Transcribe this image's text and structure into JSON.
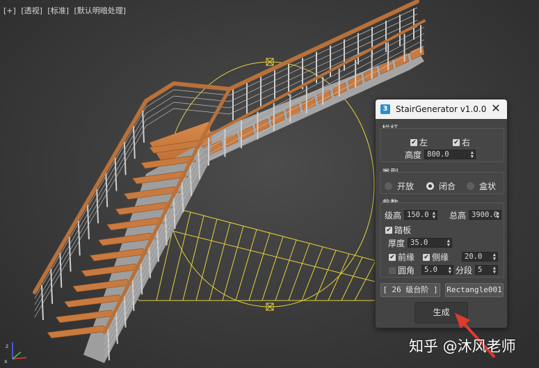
{
  "viewport": {
    "labels": [
      "[+]",
      "[透视]",
      "[标准]",
      "[默认明暗处理]"
    ]
  },
  "panel": {
    "title": "StairGenerator v1.0.0",
    "app_icon": "3",
    "close_icon": "close-icon",
    "railing": {
      "group_label": "栏杆",
      "left_label": "左",
      "left_checked": true,
      "right_label": "右",
      "right_checked": true,
      "height_label": "高度",
      "height_value": "800.0"
    },
    "type": {
      "group_label": "类型",
      "options": [
        "开放",
        "闭合",
        "盒状"
      ],
      "selected": "闭合"
    },
    "params": {
      "group_label": "参数",
      "rise_label": "级高",
      "rise_value": "150.0",
      "total_height_label": "总高",
      "total_height_value": "3900.0",
      "tread_label": "踏板",
      "tread_checked": true,
      "thickness_label": "厚度",
      "thickness_value": "35.0",
      "front_edge_label": "前缘",
      "front_edge_checked": true,
      "side_edge_label": "侧缘",
      "side_edge_checked": true,
      "side_edge_value": "20.0",
      "round_label": "圆角",
      "round_checked": false,
      "round_value": "5.0",
      "segments_label": "分段",
      "segments_value": "5"
    },
    "step_count_button": "[ 26 级台阶 ]",
    "shape_button": "Rectangle001",
    "generate_button": "生成"
  },
  "watermark": "知乎 @沐风老师",
  "colors": {
    "tread": "#c97a3f",
    "handrail": "#b8713a",
    "stringer": "#9a9a9a",
    "selection": "#e8d13a",
    "annotation_arrow": "#e03a2e"
  }
}
